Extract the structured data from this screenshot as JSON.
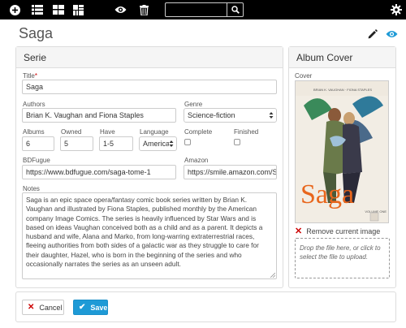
{
  "toolbar": {
    "icons": [
      "add-circle-icon",
      "list-icon",
      "grid-icon",
      "mosaic-icon",
      "eye-icon",
      "trash-icon",
      "search-icon",
      "settings-gear-icon"
    ],
    "search_value": ""
  },
  "header": {
    "title": "Saga",
    "edit_icon": "pencil-icon",
    "view_icon": "eye-icon",
    "accent_color": "#1e9ad6"
  },
  "serie_panel": {
    "heading": "Serie",
    "title": {
      "label": "Title",
      "required_mark": "*",
      "value": "Saga"
    },
    "authors": {
      "label": "Authors",
      "value": "Brian K. Vaughan and Fiona Staples"
    },
    "genre": {
      "label": "Genre",
      "value": "Science-fiction"
    },
    "albums": {
      "label": "Albums",
      "value": "6"
    },
    "owned": {
      "label": "Owned",
      "value": "5"
    },
    "have": {
      "label": "Have",
      "value": "1-5"
    },
    "language": {
      "label": "Language",
      "value": "American"
    },
    "complete": {
      "label": "Complete",
      "checked": false
    },
    "finished": {
      "label": "Finished",
      "checked": false
    },
    "bdfugue": {
      "label": "BDFugue",
      "value": "https://www.bdfugue.com/saga-tome-1"
    },
    "amazon": {
      "label": "Amazon",
      "value": "https://smile.amazon.com/Saga"
    },
    "notes": {
      "label": "Notes",
      "value": "Saga is an epic space opera/fantasy comic book series written by Brian K. Vaughan and illustrated by Fiona Staples, published monthly by the American company Image Comics. The series is heavily influenced by Star Wars and is based on ideas Vaughan conceived both as a child and as a parent. It depicts a husband and wife, Alana and Marko, from long-warring extraterrestrial races, fleeing authorities from both sides of a galactic war as they struggle to care for their daughter, Hazel, who is born in the beginning of the series and who occasionally narrates the series as an unseen adult."
    }
  },
  "cover_panel": {
    "heading": "Album Cover",
    "cover_label": "Cover",
    "cover_art_title": "Saga",
    "cover_art_credits": "BRIAN K. VAUGHAN · FIONA STAPLES",
    "cover_art_volume": "VOLUME ONE",
    "remove_label": "Remove current image",
    "dropzone_text": "Drop the file here, or click to select the file to upload."
  },
  "footer": {
    "cancel_label": "Cancel",
    "save_label": "Save"
  }
}
